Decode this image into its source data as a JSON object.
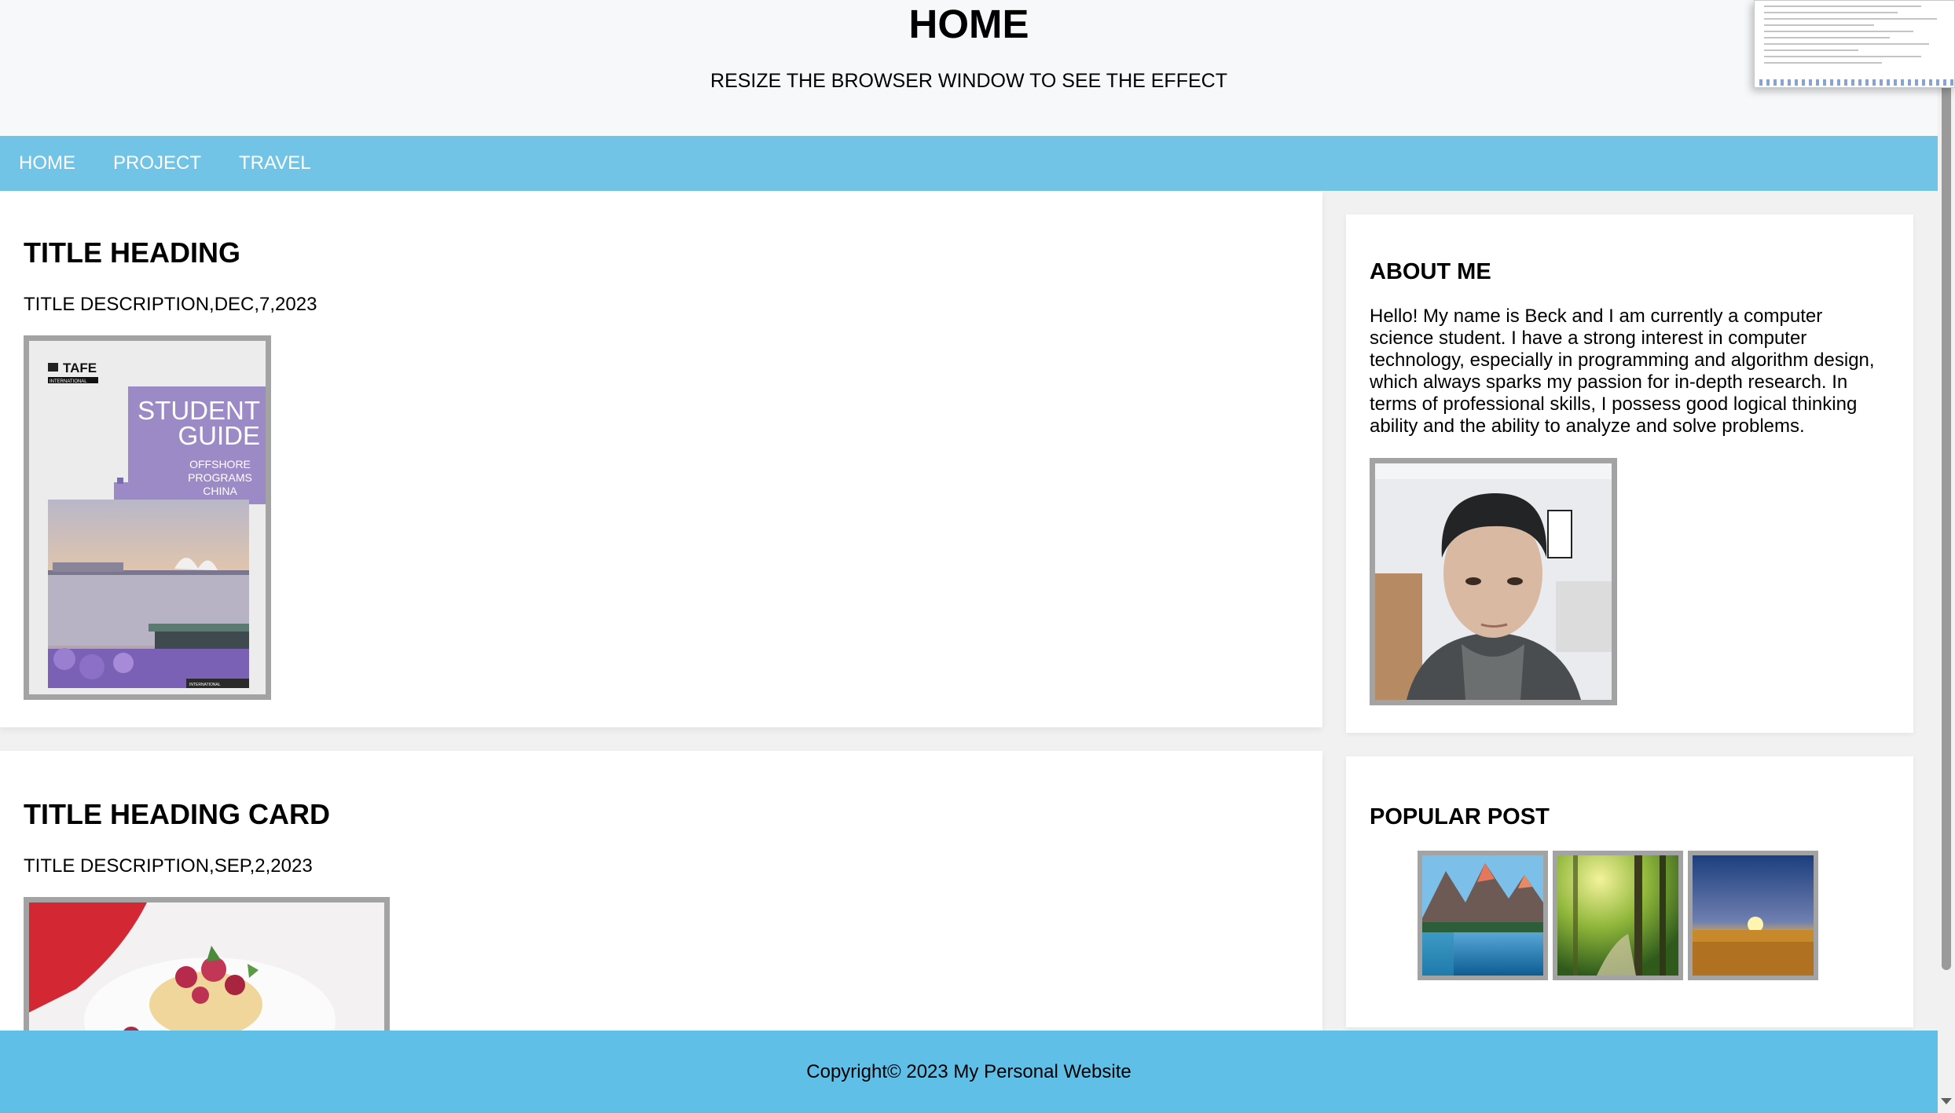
{
  "header": {
    "title": "HOME",
    "subtitle": "RESIZE THE BROWSER WINDOW TO SEE THE EFFECT"
  },
  "nav": {
    "items": [
      {
        "label": "HOME"
      },
      {
        "label": "PROJECT"
      },
      {
        "label": "TRAVEL"
      }
    ]
  },
  "posts": [
    {
      "title": "TITLE HEADING",
      "description": "TITLE DESCRIPTION,DEC,7,2023",
      "cover": {
        "brand": "TAFE",
        "brand_sub": "INTERNATIONAL",
        "heading_line1": "STUDENT",
        "heading_line2": "GUIDE",
        "line1": "OFFSHORE",
        "line2": "PROGRAMS",
        "line3": "CHINA",
        "footer": "INTERNATIONAL"
      }
    },
    {
      "title": "TITLE HEADING CARD",
      "description": "TITLE DESCRIPTION,SEP,2,2023"
    }
  ],
  "about": {
    "title": "ABOUT ME",
    "text": "Hello! My name is Beck and I am currently a computer science student. I have a strong interest in computer technology, especially in programming and algorithm design, which always sparks my passion for in-depth research. In terms of professional skills, I possess good logical thinking ability and the ability to analyze and solve problems."
  },
  "popular": {
    "title": "POPULAR POST"
  },
  "footer": {
    "text": "Copyright© 2023 My Personal Website"
  },
  "colors": {
    "nav_bg": "#71c4e6",
    "footer_bg": "#5fbfe7",
    "frame_border": "#a3a3a3",
    "cover_purple": "#9b8ac6"
  }
}
